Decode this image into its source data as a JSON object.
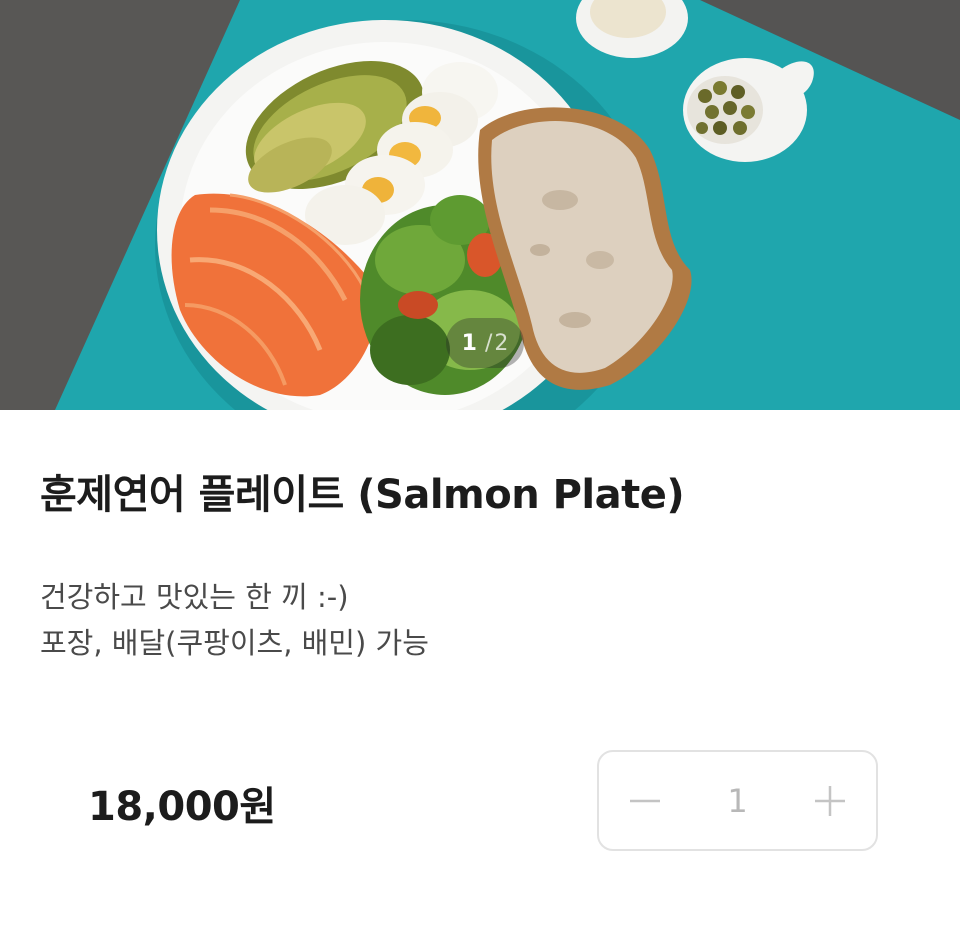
{
  "image": {
    "pager_current": "1",
    "pager_separator": "/",
    "pager_total": "2"
  },
  "product": {
    "title": "훈제연어 플레이트 (Salmon Plate)",
    "description_lines": [
      "건강하고 맛있는 한 끼 :-)",
      "포장, 배달(쿠팡이츠, 배민) 가능"
    ],
    "price": "18,000원"
  },
  "quantity": {
    "value": "1",
    "decrement_icon": "minus-icon",
    "increment_icon": "plus-icon"
  },
  "colors": {
    "background": "#ffffff",
    "tray": "#1fa6ad",
    "table": "#5a5958",
    "stepper_border": "#e2e2e2",
    "stepper_icon": "#c4c4c4"
  }
}
